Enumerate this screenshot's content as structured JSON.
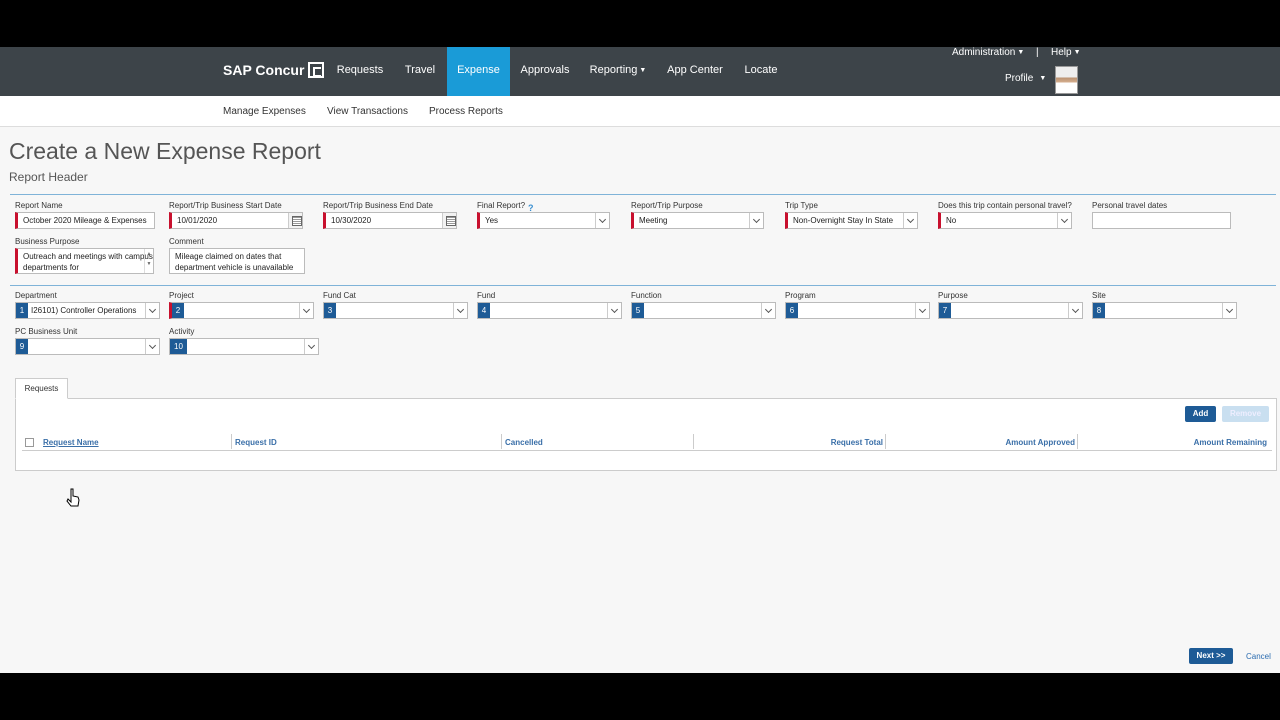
{
  "brand": {
    "name": "SAP Concur"
  },
  "topnav": {
    "tabs": [
      {
        "label": "Requests"
      },
      {
        "label": "Travel"
      },
      {
        "label": "Expense"
      },
      {
        "label": "Approvals"
      },
      {
        "label": "Reporting"
      },
      {
        "label": "App Center"
      },
      {
        "label": "Locate"
      }
    ],
    "administration": "Administration",
    "separator": "|",
    "help": "Help",
    "profile": "Profile"
  },
  "subnav": {
    "links": [
      {
        "label": "Manage Expenses"
      },
      {
        "label": "View Transactions"
      },
      {
        "label": "Process Reports"
      }
    ]
  },
  "page": {
    "title": "Create a New Expense Report",
    "subtitle": "Report Header"
  },
  "header_fields": {
    "report_name": {
      "label": "Report Name",
      "value": "October 2020 Mileage & Expenses"
    },
    "start_date": {
      "label": "Report/Trip Business Start Date",
      "value": "10/01/2020"
    },
    "end_date": {
      "label": "Report/Trip Business End Date",
      "value": "10/30/2020"
    },
    "final_report": {
      "label": "Final Report?",
      "value": "Yes",
      "help_icon": "?"
    },
    "purpose": {
      "label": "Report/Trip Purpose",
      "value": "Meeting"
    },
    "trip_type": {
      "label": "Trip Type",
      "value": "Non-Overnight Stay In State"
    },
    "personal_travel": {
      "label": "Does this trip contain personal travel?",
      "value": "No"
    },
    "personal_dates": {
      "label": "Personal travel dates",
      "value": ""
    },
    "business_purpose": {
      "label": "Business Purpose",
      "value": "Outreach and meetings with campus departments for"
    },
    "comment": {
      "label": "Comment",
      "value": "Mileage claimed on dates that department vehicle is unavailable"
    }
  },
  "allocation_fields": [
    {
      "label": "Department",
      "num": "1",
      "value": "I26101) Controller Operations"
    },
    {
      "label": "Project",
      "num": "2",
      "value": ""
    },
    {
      "label": "Fund Cat",
      "num": "3",
      "value": ""
    },
    {
      "label": "Fund",
      "num": "4",
      "value": ""
    },
    {
      "label": "Function",
      "num": "5",
      "value": ""
    },
    {
      "label": "Program",
      "num": "6",
      "value": ""
    },
    {
      "label": "Purpose",
      "num": "7",
      "value": ""
    },
    {
      "label": "Site",
      "num": "8",
      "value": ""
    },
    {
      "label": "PC Business Unit",
      "num": "9",
      "value": ""
    },
    {
      "label": "Activity",
      "num": "10",
      "value": ""
    }
  ],
  "requests": {
    "tab_label": "Requests",
    "add_label": "Add",
    "remove_label": "Remove",
    "columns": [
      "Request Name",
      "Request ID",
      "Cancelled",
      "Request Total",
      "Amount Approved",
      "Amount Remaining"
    ]
  },
  "footer": {
    "next_label": "Next >>",
    "cancel_label": "Cancel"
  }
}
